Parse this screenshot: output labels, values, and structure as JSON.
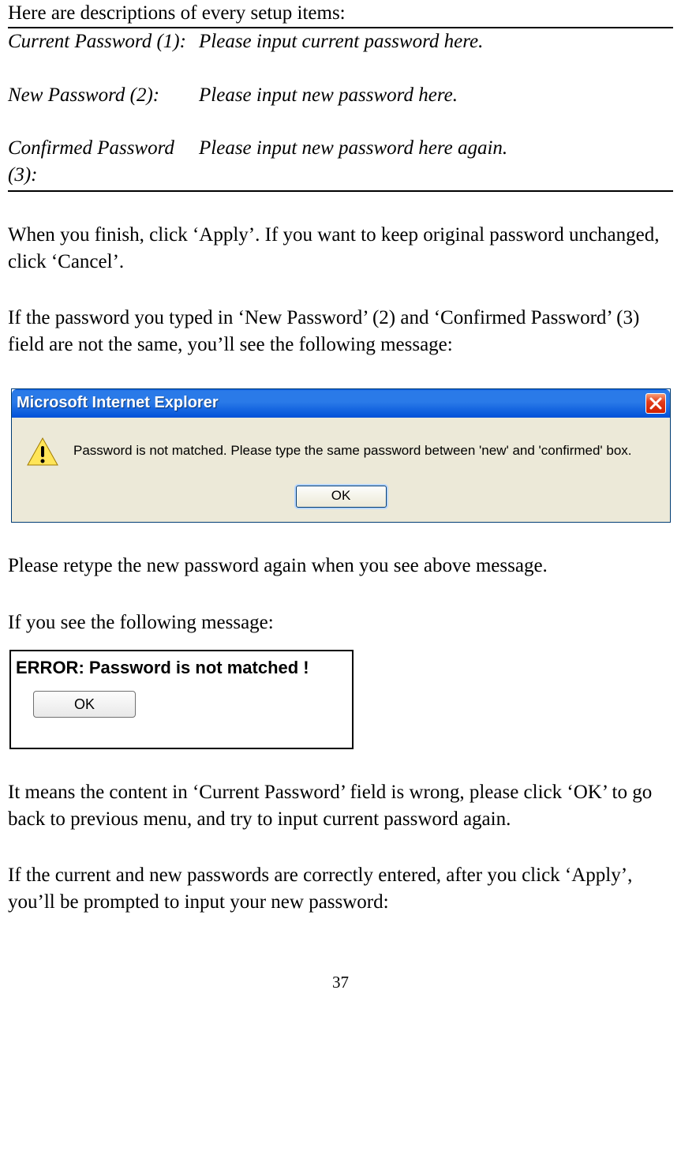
{
  "intro": "Here are descriptions of every setup items:",
  "defs": {
    "current": {
      "label": "Current Password (1):",
      "desc": "Please input current password here."
    },
    "new": {
      "label": "New Password (2):",
      "desc": "Please input new password here."
    },
    "confirmed": {
      "label": "Confirmed Password (3):",
      "desc": "Please input new password here again."
    }
  },
  "p1": "When you finish, click ‘Apply’. If you want to keep original password unchanged, click ‘Cancel’.",
  "p2": "If the password you typed in ‘New Password’ (2) and ‘Confirmed Password’ (3) field are not the same, you’ll see the following message:",
  "dialog1": {
    "title": "Microsoft Internet Explorer",
    "message": "Password is not matched. Please type the same password between 'new' and 'confirmed' box.",
    "ok": "OK"
  },
  "p3": "Please retype the new password again when you see above message.",
  "p4": "If you see the following message:",
  "dialog2": {
    "message": "ERROR: Password is not matched !",
    "ok": "OK"
  },
  "p5": "It means the content in ‘Current Password’ field is wrong, please click ‘OK’ to go back to previous menu, and try to input current password again.",
  "p6": "If the current and new passwords are correctly entered, after you click ‘Apply’, you’ll be prompted to input your new password:",
  "page_number": "37"
}
